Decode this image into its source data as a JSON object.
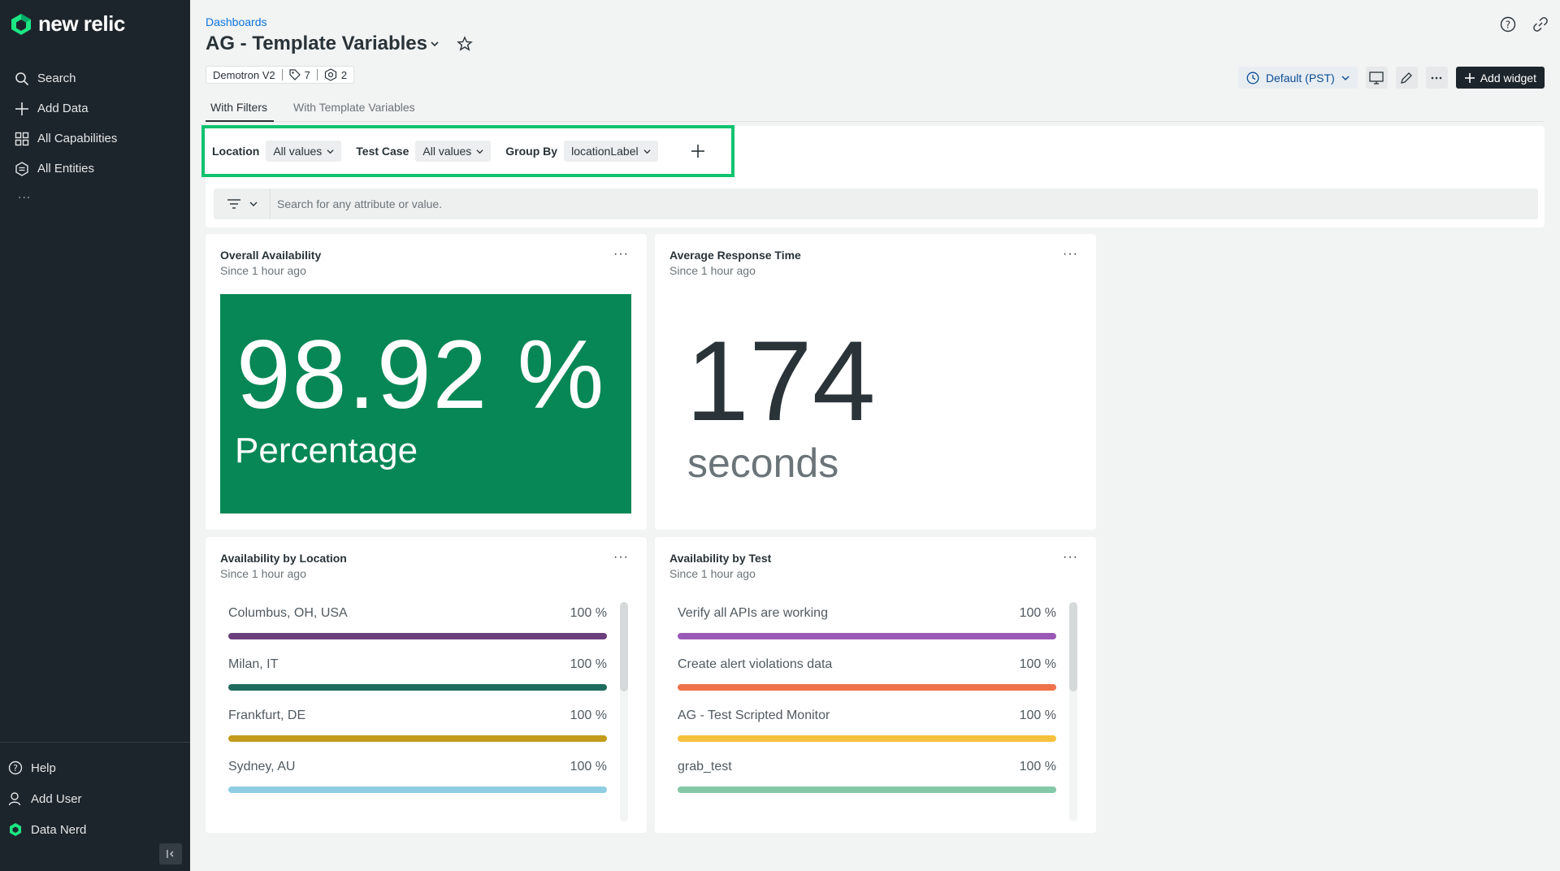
{
  "brand": {
    "name": "new relic"
  },
  "sidebar": {
    "items": [
      {
        "label": "Search",
        "icon": "search-icon"
      },
      {
        "label": "Add Data",
        "icon": "plus-icon"
      },
      {
        "label": "All Capabilities",
        "icon": "grid-icon"
      },
      {
        "label": "All Entities",
        "icon": "entities-icon"
      }
    ],
    "more": "...",
    "bottom": [
      {
        "label": "Help",
        "icon": "help-icon"
      },
      {
        "label": "Add User",
        "icon": "add-user-icon"
      },
      {
        "label": "Data Nerd",
        "icon": "logo-icon"
      }
    ]
  },
  "header": {
    "breadcrumb": "Dashboards",
    "title": "AG - Template Variables",
    "account": "Demotron V2",
    "tags_count": "7",
    "entities_count": "2"
  },
  "toolbar": {
    "timezone": "Default (PST)",
    "add_widget": "Add widget"
  },
  "tabs": [
    {
      "label": "With Filters",
      "active": true
    },
    {
      "label": "With Template Variables",
      "active": false
    }
  ],
  "filters": [
    {
      "label": "Location",
      "value": "All values"
    },
    {
      "label": "Test Case",
      "value": "All values"
    },
    {
      "label": "Group By",
      "value": "locationLabel"
    }
  ],
  "search": {
    "placeholder": "Search for any attribute or value."
  },
  "widgets": {
    "availability": {
      "title": "Overall Availability",
      "subtitle": "Since 1 hour ago",
      "value": "98.92 %",
      "unit": "Percentage",
      "color": "#078755"
    },
    "response": {
      "title": "Average Response Time",
      "subtitle": "Since 1 hour ago",
      "value": "174",
      "unit": "seconds"
    },
    "by_location": {
      "title": "Availability by Location",
      "subtitle": "Since 1 hour ago",
      "rows": [
        {
          "label": "Columbus, OH, USA",
          "value": "100 %",
          "color": "#6b3e7d"
        },
        {
          "label": "Milan, IT",
          "value": "100 %",
          "color": "#1f6b5d"
        },
        {
          "label": "Frankfurt, DE",
          "value": "100 %",
          "color": "#c49b1d"
        },
        {
          "label": "Sydney, AU",
          "value": "100 %",
          "color": "#8fcde3"
        }
      ]
    },
    "by_test": {
      "title": "Availability by Test",
      "subtitle": "Since 1 hour ago",
      "rows": [
        {
          "label": "Verify all APIs are working",
          "value": "100 %",
          "color": "#9b59b6"
        },
        {
          "label": "Create alert violations data",
          "value": "100 %",
          "color": "#f0724a"
        },
        {
          "label": "AG - Test Scripted Monitor",
          "value": "100 %",
          "color": "#f5c13c"
        },
        {
          "label": "grab_test",
          "value": "100 %",
          "color": "#83c9a8"
        }
      ]
    }
  }
}
